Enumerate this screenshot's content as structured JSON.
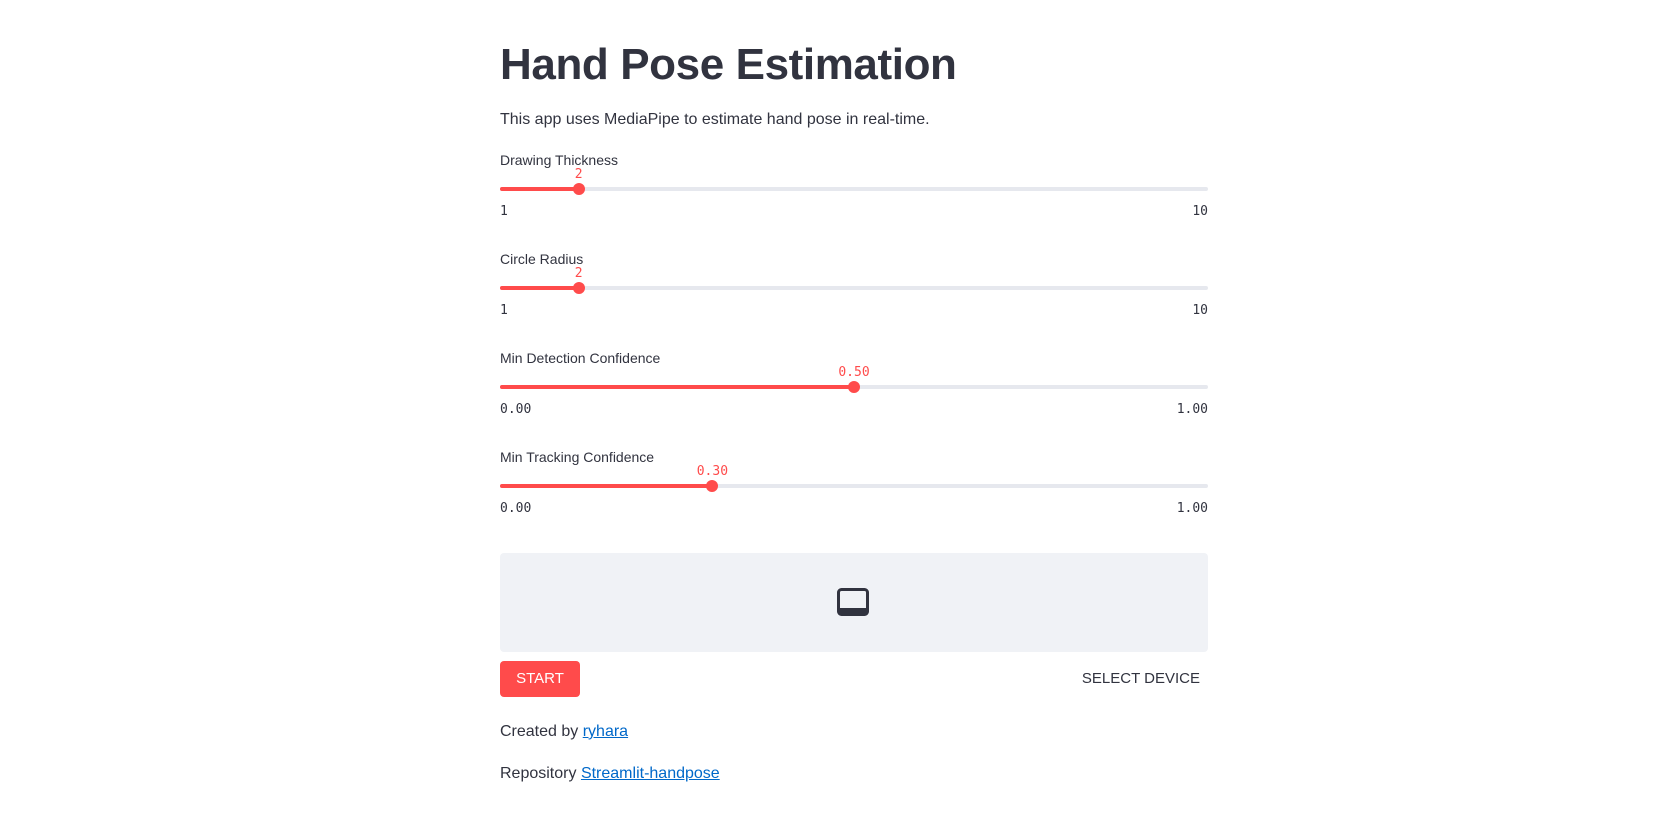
{
  "app": {
    "title": "Hand Pose Estimation",
    "description": "This app uses MediaPipe to estimate hand pose in real-time."
  },
  "sliders": [
    {
      "label": "Drawing Thickness",
      "value": 2,
      "value_text": "2",
      "min": 1,
      "max": 10,
      "min_text": "1",
      "max_text": "10"
    },
    {
      "label": "Circle Radius",
      "value": 2,
      "value_text": "2",
      "min": 1,
      "max": 10,
      "min_text": "1",
      "max_text": "10"
    },
    {
      "label": "Min Detection Confidence",
      "value": 0.5,
      "value_text": "0.50",
      "min": 0,
      "max": 1,
      "min_text": "0.00",
      "max_text": "1.00"
    },
    {
      "label": "Min Tracking Confidence",
      "value": 0.3,
      "value_text": "0.30",
      "min": 0,
      "max": 1,
      "min_text": "0.00",
      "max_text": "1.00"
    }
  ],
  "webrtc": {
    "video_icon": "video-display-icon",
    "start_label": "START",
    "select_device_label": "SELECT DEVICE"
  },
  "footer": {
    "created_prefix": "Created by",
    "created_link": "ryhara",
    "repo_prefix": "Repository",
    "repo_link": "Streamlit-handpose"
  },
  "colors": {
    "accent": "#ff4b4b",
    "text": "#31333f",
    "track": "#e6e8ee",
    "panel": "#f0f2f6",
    "link": "#0068c9"
  }
}
